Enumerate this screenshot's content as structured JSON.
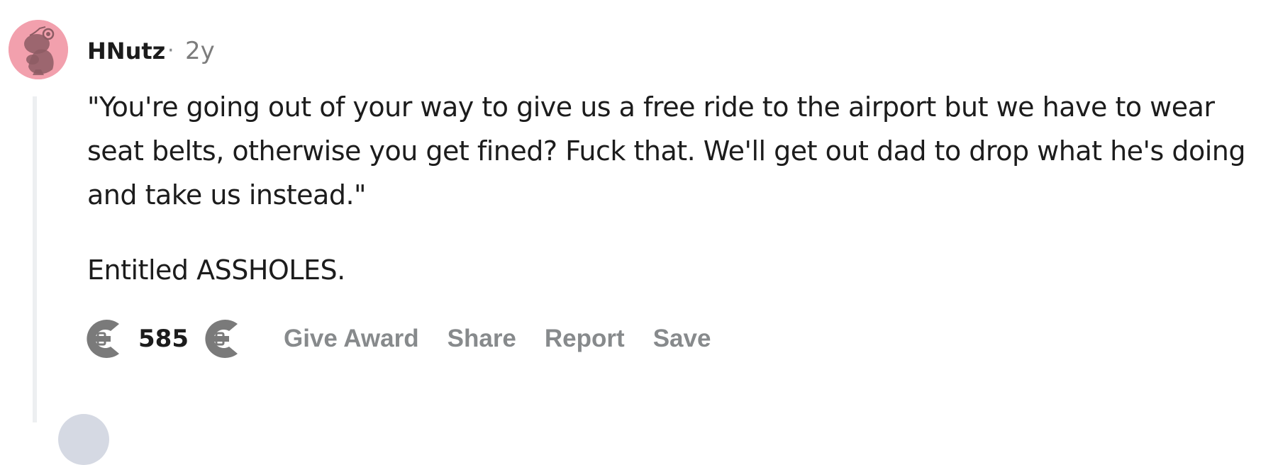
{
  "comment": {
    "author": "HNutz",
    "separator": "·",
    "age": "2y",
    "body": [
      "\"You're going out of your way to give us a free ride to the airport but we have to wear seat belts, otherwise you get fined? Fuck that. We'll get out dad to drop what he's doing and take us instead.\"",
      "Entitled ASSHOLES."
    ],
    "score": "585",
    "actions": {
      "give_award": "Give Award",
      "share": "Share",
      "report": "Report",
      "save": "Save"
    }
  },
  "icons": {
    "avatar": "snoo-avatar-icon",
    "upvote": "upvote-icon",
    "downvote": "downvote-icon"
  },
  "colors": {
    "avatar_bg": "#f2a0ad",
    "action_text": "#878a8c",
    "thread_line": "#edeff1",
    "vote_icon": "#7a7a7a"
  }
}
